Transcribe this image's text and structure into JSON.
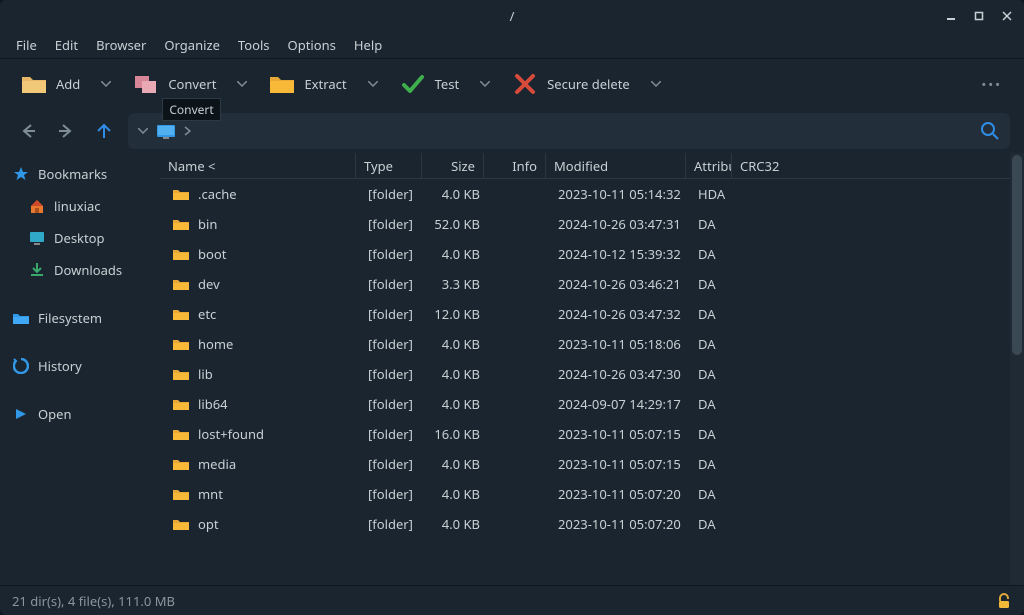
{
  "window": {
    "title": "/"
  },
  "menubar": [
    "File",
    "Edit",
    "Browser",
    "Organize",
    "Tools",
    "Options",
    "Help"
  ],
  "toolbar": {
    "add": "Add",
    "convert": "Convert",
    "convert_tooltip": "Convert",
    "extract": "Extract",
    "test": "Test",
    "secure_delete": "Secure delete"
  },
  "sidebar": {
    "bookmarks": "Bookmarks",
    "children": [
      {
        "label": "linuxiac",
        "icon": "home"
      },
      {
        "label": "Desktop",
        "icon": "desktop"
      },
      {
        "label": "Downloads",
        "icon": "download"
      }
    ],
    "filesystem": "Filesystem",
    "history": "History",
    "open": "Open"
  },
  "columns": {
    "name": "Name <",
    "type": "Type",
    "size": "Size",
    "info": "Info",
    "modified": "Modified",
    "attributes": "Attributes",
    "crc32": "CRC32"
  },
  "files": [
    {
      "name": ".cache",
      "type": "[folder]",
      "size": "4.0 KB",
      "modified": "2023-10-11 05:14:32",
      "attr": "HDA"
    },
    {
      "name": "bin",
      "type": "[folder]",
      "size": "52.0 KB",
      "modified": "2024-10-26 03:47:31",
      "attr": "DA"
    },
    {
      "name": "boot",
      "type": "[folder]",
      "size": "4.0 KB",
      "modified": "2024-10-12 15:39:32",
      "attr": "DA"
    },
    {
      "name": "dev",
      "type": "[folder]",
      "size": "3.3 KB",
      "modified": "2024-10-26 03:46:21",
      "attr": "DA"
    },
    {
      "name": "etc",
      "type": "[folder]",
      "size": "12.0 KB",
      "modified": "2024-10-26 03:47:32",
      "attr": "DA"
    },
    {
      "name": "home",
      "type": "[folder]",
      "size": "4.0 KB",
      "modified": "2023-10-11 05:18:06",
      "attr": "DA"
    },
    {
      "name": "lib",
      "type": "[folder]",
      "size": "4.0 KB",
      "modified": "2024-10-26 03:47:30",
      "attr": "DA"
    },
    {
      "name": "lib64",
      "type": "[folder]",
      "size": "4.0 KB",
      "modified": "2024-09-07 14:29:17",
      "attr": "DA"
    },
    {
      "name": "lost+found",
      "type": "[folder]",
      "size": "16.0 KB",
      "modified": "2023-10-11 05:07:15",
      "attr": "DA"
    },
    {
      "name": "media",
      "type": "[folder]",
      "size": "4.0 KB",
      "modified": "2023-10-11 05:07:15",
      "attr": "DA"
    },
    {
      "name": "mnt",
      "type": "[folder]",
      "size": "4.0 KB",
      "modified": "2023-10-11 05:07:20",
      "attr": "DA"
    },
    {
      "name": "opt",
      "type": "[folder]",
      "size": "4.0 KB",
      "modified": "2023-10-11 05:07:20",
      "attr": "DA"
    }
  ],
  "status": "21 dir(s), 4 file(s), 111.0 MB"
}
